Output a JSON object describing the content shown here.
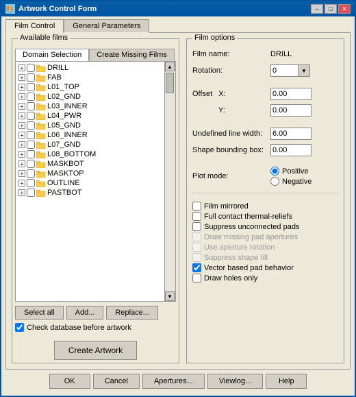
{
  "window": {
    "title": "Artwork Control Form",
    "icon": "🎨"
  },
  "tabs": [
    {
      "id": "film-control",
      "label": "Film Control",
      "active": true
    },
    {
      "id": "general-parameters",
      "label": "General Parameters",
      "active": false
    }
  ],
  "left_panel": {
    "group_label": "Available films",
    "inner_tabs": [
      {
        "id": "domain-selection",
        "label": "Domain Selection",
        "active": true
      },
      {
        "id": "create-missing-films",
        "label": "Create Missing Films",
        "active": false
      }
    ],
    "films": [
      "DRILL",
      "FAB",
      "L01_TOP",
      "L02_GND",
      "L03_INNER",
      "L04_PWR",
      "L05_GND",
      "L06_INNER",
      "L07_GND",
      "L08_BOTTOM",
      "MASKBOT",
      "MASKTOP",
      "OUTLINE",
      "PASTBOT"
    ],
    "buttons": {
      "select_all": "Select all",
      "add": "Add...",
      "replace": "Replace..."
    },
    "check_database": "Check database before artwork",
    "create_artwork": "Create Artwork"
  },
  "right_panel": {
    "group_label": "Film options",
    "film_name_label": "Film name:",
    "film_name_value": "DRILL",
    "rotation_label": "Rotation:",
    "rotation_value": "0",
    "offset_label": "Offset",
    "offset_x_label": "X:",
    "offset_x_value": "0.00",
    "offset_y_label": "Y:",
    "offset_y_value": "0.00",
    "undefined_line_width_label": "Undefined line width:",
    "undefined_line_width_value": "6.00",
    "shape_bounding_box_label": "Shape bounding box:",
    "shape_bounding_box_value": "0.00",
    "plot_mode_label": "Plot mode:",
    "plot_positive_label": "Positive",
    "plot_negative_label": "Negative",
    "checkboxes": [
      {
        "id": "film-mirrored",
        "label": "Film mirrored",
        "checked": false,
        "disabled": false
      },
      {
        "id": "full-contact-thermal-reliefs",
        "label": "Full contact thermal-reliefs",
        "checked": false,
        "disabled": false
      },
      {
        "id": "suppress-unconnected-pads",
        "label": "Suppress unconnected pads",
        "checked": false,
        "disabled": false
      },
      {
        "id": "draw-missing-pad-apertures",
        "label": "Draw missing pad apertures",
        "checked": false,
        "disabled": true
      },
      {
        "id": "use-aperture-rotation",
        "label": "Use aperture rotation",
        "checked": false,
        "disabled": true
      },
      {
        "id": "suppress-shape-fill",
        "label": "Suppress shape fill",
        "checked": false,
        "disabled": true
      },
      {
        "id": "vector-based-pad-behavior",
        "label": "Vector based pad behavior",
        "checked": true,
        "disabled": false
      },
      {
        "id": "draw-holes-only",
        "label": "Draw holes only",
        "checked": false,
        "disabled": false
      }
    ]
  },
  "bottom_buttons": [
    {
      "id": "ok",
      "label": "OK"
    },
    {
      "id": "cancel",
      "label": "Cancel"
    },
    {
      "id": "apertures",
      "label": "Apertures..."
    },
    {
      "id": "viewlog",
      "label": "Viewlog..."
    },
    {
      "id": "help",
      "label": "Help"
    }
  ]
}
